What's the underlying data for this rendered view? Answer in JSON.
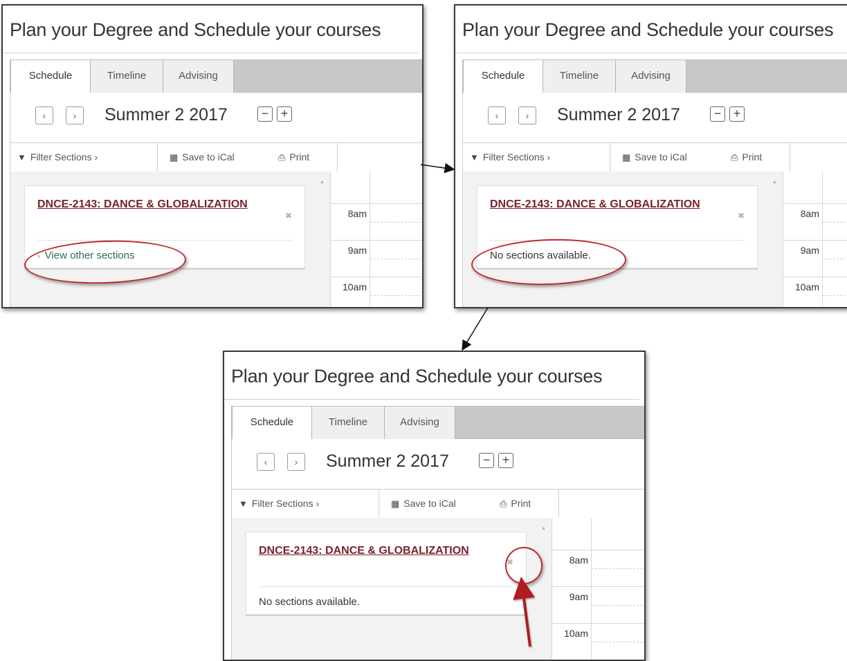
{
  "panels": [
    {
      "title": "Plan your Degree and Schedule your courses",
      "tabs": [
        "Schedule",
        "Timeline",
        "Advising"
      ],
      "active_tab": "Schedule",
      "term": "Summer 2 2017",
      "nav": {
        "prev": "‹",
        "next": "›",
        "zoom_out": "−",
        "zoom_in": "+"
      },
      "toolbar": {
        "filter": "Filter Sections ›",
        "ical": "Save to iCal",
        "print": "Print"
      },
      "course": {
        "title": "DNCE-2143: DANCE & GLOBALIZATION",
        "close": "✖",
        "sections": "View other sections",
        "chevron": "›"
      },
      "hours": [
        "8am",
        "9am",
        "10am"
      ]
    },
    {
      "title": "Plan your Degree and Schedule your courses",
      "tabs": [
        "Schedule",
        "Timeline",
        "Advising"
      ],
      "active_tab": "Schedule",
      "term": "Summer 2 2017",
      "nav": {
        "prev": "‹",
        "next": "›",
        "zoom_out": "−",
        "zoom_in": "+"
      },
      "toolbar": {
        "filter": "Filter Sections ›",
        "ical": "Save to iCal",
        "print": "Print"
      },
      "course": {
        "title": "DNCE-2143: DANCE & GLOBALIZATION",
        "close": "✖",
        "sections": "No sections available."
      },
      "hours": [
        "8am",
        "9am",
        "10am"
      ]
    },
    {
      "title": "Plan your Degree and Schedule your courses",
      "tabs": [
        "Schedule",
        "Timeline",
        "Advising"
      ],
      "active_tab": "Schedule",
      "term": "Summer 2 2017",
      "nav": {
        "prev": "‹",
        "next": "›",
        "zoom_out": "−",
        "zoom_in": "+"
      },
      "toolbar": {
        "filter": "Filter Sections ›",
        "ical": "Save to iCal",
        "print": "Print"
      },
      "course": {
        "title": "DNCE-2143: DANCE & GLOBALIZATION",
        "close": "✖",
        "sections": "No sections available."
      },
      "hours": [
        "8am",
        "9am",
        "10am"
      ]
    }
  ],
  "icons": {
    "filter": "filter-icon",
    "calendar": "calendar-icon",
    "print": "printer-icon"
  },
  "colors": {
    "course_link": "#7a1f2a",
    "sections_link": "#2c6b5a",
    "annotation": "#c0282d",
    "tabbar": "#c8c8c8"
  }
}
